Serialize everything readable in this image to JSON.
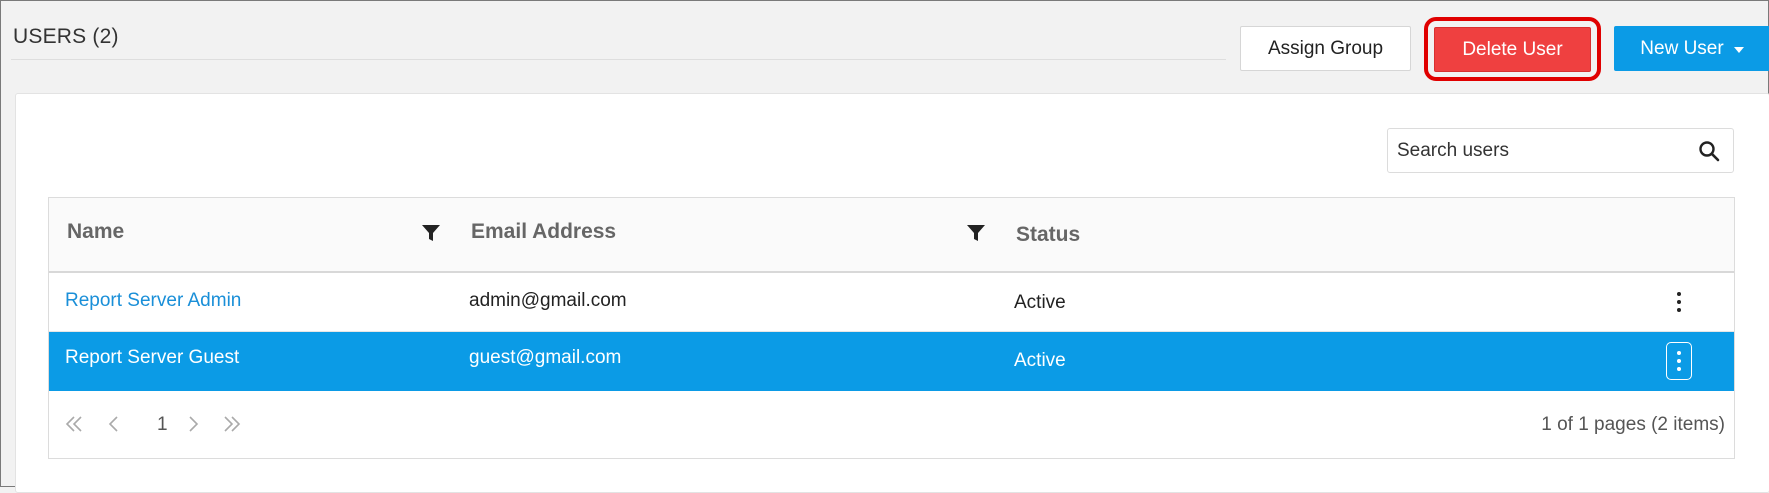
{
  "header": {
    "title": "USERS (2)"
  },
  "toolbar": {
    "assign_group_label": "Assign Group",
    "delete_user_label": "Delete User",
    "new_user_label": "New User"
  },
  "search": {
    "placeholder": "Search users",
    "value": ""
  },
  "grid": {
    "columns": [
      {
        "label": "Name",
        "filterable": true
      },
      {
        "label": "Email Address",
        "filterable": true
      },
      {
        "label": "Status",
        "filterable": false
      }
    ],
    "rows": [
      {
        "name": "Report Server Admin",
        "email": "admin@gmail.com",
        "status": "Active",
        "selected": false
      },
      {
        "name": "Report Server Guest",
        "email": "guest@gmail.com",
        "status": "Active",
        "selected": true
      }
    ]
  },
  "pager": {
    "current_page": "1",
    "info": "1 of 1 pages (2 items)"
  },
  "colors": {
    "accent": "#0b9be6",
    "danger": "#ef4040",
    "highlight": "#e00000",
    "link": "#1a8fd8"
  }
}
